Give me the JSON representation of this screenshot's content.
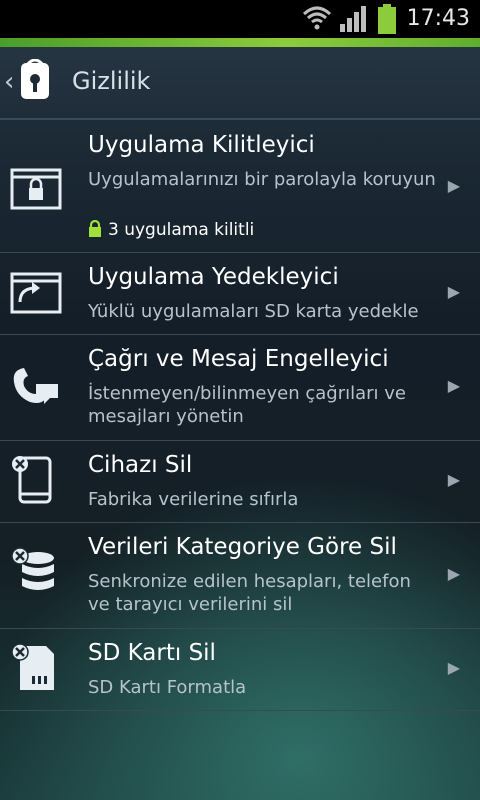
{
  "status_bar": {
    "time": "17:43",
    "icons": [
      "wifi-icon",
      "signal-icon",
      "battery-icon"
    ]
  },
  "header": {
    "title": "Gizlilik",
    "back_icon": "chevron-left-icon",
    "logo_icon": "lock-app-icon"
  },
  "items": [
    {
      "title": "Uygulama Kilitleyici",
      "subtitle": "Uygulamalarınızı bir parolayla koruyun",
      "status": "3 uygulama kilitli",
      "icon": "app-lock-icon"
    },
    {
      "title": "Uygulama Yedekleyici",
      "subtitle": "Yüklü uygulamaları SD karta yedekle",
      "icon": "app-backup-icon"
    },
    {
      "title": "Çağrı ve Mesaj Engelleyici",
      "subtitle": "İstenmeyen/bilinmeyen çağrıları ve mesajları yönetin",
      "icon": "call-message-block-icon"
    },
    {
      "title": "Cihazı Sil",
      "subtitle": "Fabrika verilerine sıfırla",
      "icon": "wipe-device-icon"
    },
    {
      "title": "Verileri Kategoriye Göre Sil",
      "subtitle": "Senkronize edilen hesapları, telefon ve tarayıcı verilerini sil",
      "icon": "wipe-data-category-icon"
    },
    {
      "title": "SD Kartı Sil",
      "subtitle": "SD Kartı Formatla",
      "icon": "wipe-sd-card-icon"
    }
  ],
  "colors": {
    "accent_green": "#8ccc3c",
    "lock_status_green": "#9fe03a",
    "icon_stroke": "#e7eef3"
  }
}
